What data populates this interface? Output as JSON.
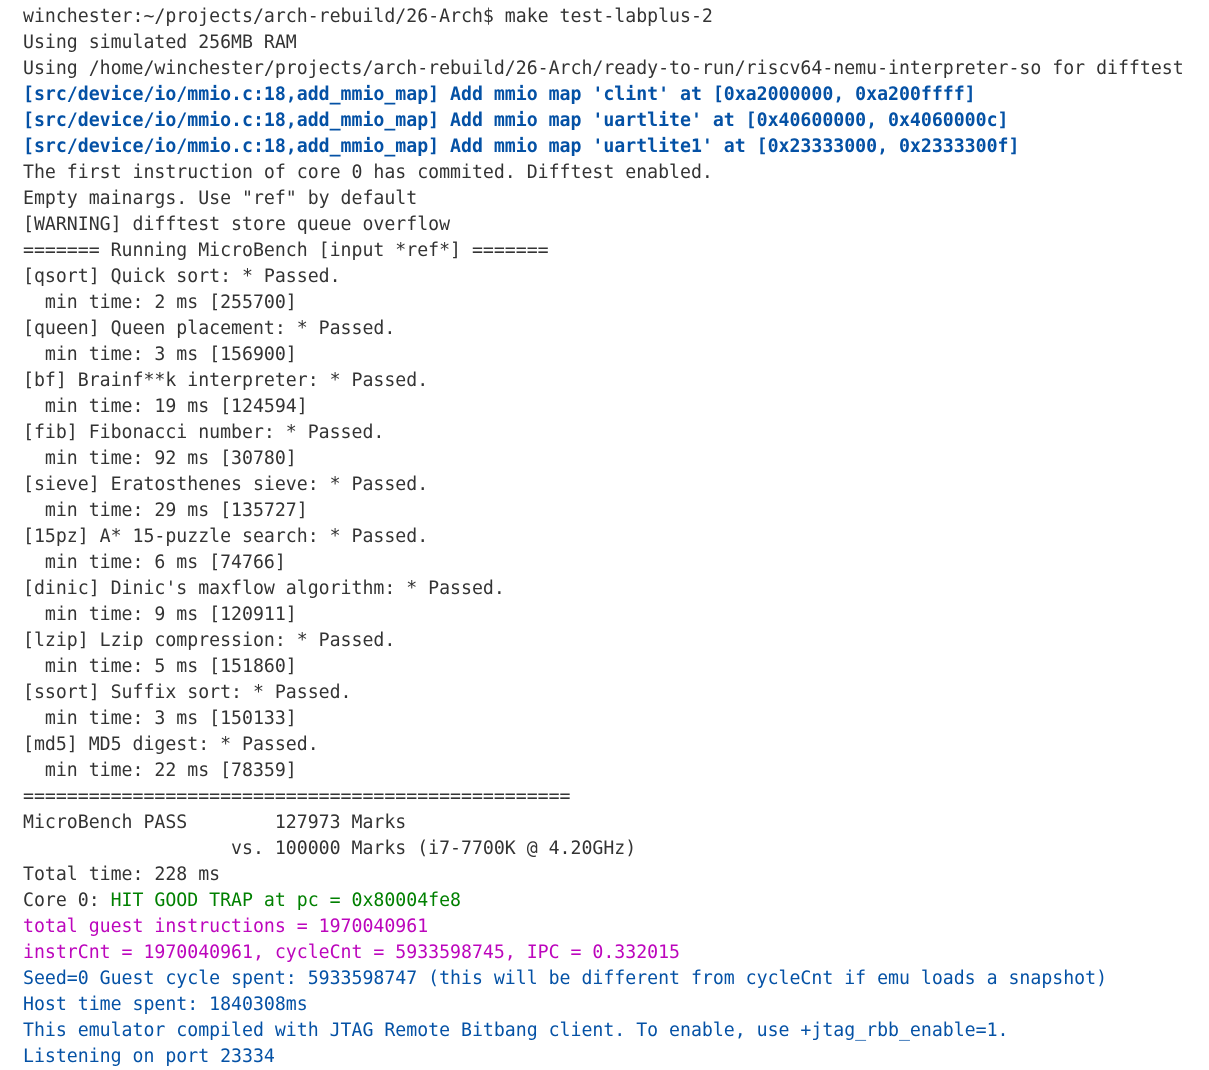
{
  "theme": {
    "background": "#ffffff",
    "default_fg": "#333333",
    "blue": "#0451a5",
    "green": "#008000",
    "magenta": "#bc05bc"
  },
  "terminal": {
    "prompt": "winchester:~/projects/arch-rebuild/26-Arch$ make test-labplus-2",
    "setup": [
      "Using simulated 256MB RAM",
      "Using /home/winchester/projects/arch-rebuild/26-Arch/ready-to-run/riscv64-nemu-interpreter-so for difftest"
    ],
    "mmio": [
      "[src/device/io/mmio.c:18,add_mmio_map] Add mmio map 'clint' at [0xa2000000, 0xa200ffff]",
      "[src/device/io/mmio.c:18,add_mmio_map] Add mmio map 'uartlite' at [0x40600000, 0x4060000c]",
      "[src/device/io/mmio.c:18,add_mmio_map] Add mmio map 'uartlite1' at [0x23333000, 0x2333300f]"
    ],
    "info": [
      "The first instruction of core 0 has commited. Difftest enabled.",
      "Empty mainargs. Use \"ref\" by default",
      "[WARNING] difftest store queue overflow",
      "======= Running MicroBench [input *ref*] ======="
    ],
    "benchmarks": [
      {
        "result": "[qsort] Quick sort: * Passed.",
        "time": "  min time: 2 ms [255700]"
      },
      {
        "result": "[queen] Queen placement: * Passed.",
        "time": "  min time: 3 ms [156900]"
      },
      {
        "result": "[bf] Brainf**k interpreter: * Passed.",
        "time": "  min time: 19 ms [124594]"
      },
      {
        "result": "[fib] Fibonacci number: * Passed.",
        "time": "  min time: 92 ms [30780]"
      },
      {
        "result": "[sieve] Eratosthenes sieve: * Passed.",
        "time": "  min time: 29 ms [135727]"
      },
      {
        "result": "[15pz] A* 15-puzzle search: * Passed.",
        "time": "  min time: 6 ms [74766]"
      },
      {
        "result": "[dinic] Dinic's maxflow algorithm: * Passed.",
        "time": "  min time: 9 ms [120911]"
      },
      {
        "result": "[lzip] Lzip compression: * Passed.",
        "time": "  min time: 5 ms [151860]"
      },
      {
        "result": "[ssort] Suffix sort: * Passed.",
        "time": "  min time: 3 ms [150133]"
      },
      {
        "result": "[md5] MD5 digest: * Passed.",
        "time": "  min time: 22 ms [78359]"
      }
    ],
    "separator": "==================================================",
    "summary": {
      "pass_line": "MicroBench PASS        127973 Marks",
      "vs_line": "                   vs. 100000 Marks (i7-7700K @ 4.20GHz)",
      "total_time": "Total time: 228 ms"
    },
    "trap": {
      "prefix": "Core 0: ",
      "message": "HIT GOOD TRAP at pc = 0x80004fe8"
    },
    "stats": {
      "guest_instructions": "total guest instructions = 1970040961",
      "ipc_line": "instrCnt = 1970040961, cycleCnt = 5933598745, IPC = 0.332015"
    },
    "tail": [
      "Seed=0 Guest cycle spent: 5933598747 (this will be different from cycleCnt if emu loads a snapshot)",
      "Host time spent: 1840308ms",
      "This emulator compiled with JTAG Remote Bitbang client. To enable, use +jtag_rbb_enable=1.",
      "Listening on port 23334"
    ]
  }
}
